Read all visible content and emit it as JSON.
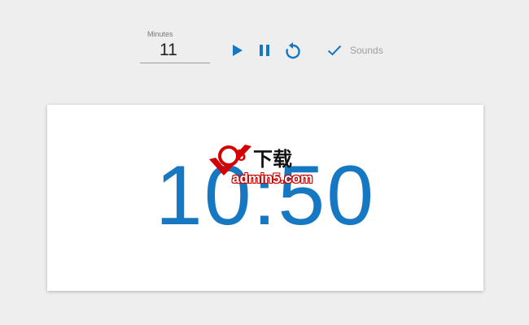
{
  "toolbar": {
    "minutes_label": "Minutes",
    "minutes_value": "11",
    "sounds_label": "Sounds"
  },
  "icons": {
    "play": "play-icon",
    "pause": "pause-icon",
    "reset": "reset-icon",
    "check": "check-icon"
  },
  "timer": {
    "display": "10:50"
  },
  "watermark": {
    "cn": "下载",
    "site": "admin5.com"
  },
  "colors": {
    "accent": "#1678c2",
    "background": "#eeeeee",
    "card": "#ffffff",
    "watermark_red": "#d40000"
  }
}
